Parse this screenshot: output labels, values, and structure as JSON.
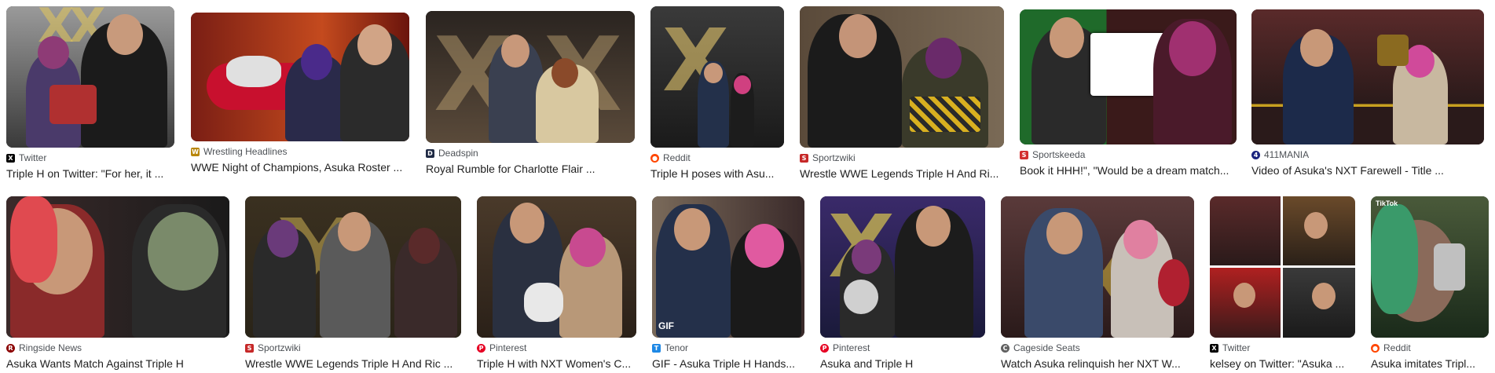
{
  "results": [
    {
      "source": "Twitter",
      "favicon": "x-logo-icon",
      "favicon_color": "#000000",
      "title": "Triple H on Twitter: \"For her, it ..."
    },
    {
      "source": "Wrestling Headlines",
      "favicon": "wrestling-headlines-icon",
      "favicon_color": "#b8860b",
      "title": "WWE Night of Champions, Asuka Roster ..."
    },
    {
      "source": "Deadspin",
      "favicon": "deadspin-icon",
      "favicon_color": "#1f2a44",
      "title": "Royal Rumble for Charlotte Flair ..."
    },
    {
      "source": "Reddit",
      "favicon": "reddit-icon",
      "favicon_color": "#ff4500",
      "title": "Triple H poses with Asu..."
    },
    {
      "source": "Sportzwiki",
      "favicon": "sportzwiki-icon",
      "favicon_color": "#c62828",
      "title": "Wrestle WWE Legends Triple H And Ri..."
    },
    {
      "source": "Sportskeeda",
      "favicon": "sportskeeda-icon",
      "favicon_color": "#d32f2f",
      "title": "Book it HHH!\", \"Would be a dream match..."
    },
    {
      "source": "411MANIA",
      "favicon": "411mania-icon",
      "favicon_color": "#1a237e",
      "title": "Video of Asuka's NXT Farewell - Title ..."
    },
    {
      "source": "Ringside News",
      "favicon": "ringside-news-icon",
      "favicon_color": "#8b0000",
      "title": "Asuka Wants Match Against Triple H"
    },
    {
      "source": "Sportzwiki",
      "favicon": "sportzwiki-icon",
      "favicon_color": "#c62828",
      "title": "Wrestle WWE Legends Triple H And Ric ..."
    },
    {
      "source": "Pinterest",
      "favicon": "pinterest-icon",
      "favicon_color": "#e60023",
      "title": "Triple H with NXT Women's C..."
    },
    {
      "source": "Tenor",
      "favicon": "tenor-icon",
      "favicon_color": "#1e88e5",
      "title": "GIF - Asuka Triple H Hands...",
      "badge": "GIF"
    },
    {
      "source": "Pinterest",
      "favicon": "pinterest-icon",
      "favicon_color": "#e60023",
      "title": "Asuka and Triple H"
    },
    {
      "source": "Cageside Seats",
      "favicon": "cageside-seats-icon",
      "favicon_color": "#616161",
      "title": "Watch Asuka relinquish her NXT W..."
    },
    {
      "source": "Twitter",
      "favicon": "x-logo-icon",
      "favicon_color": "#000000",
      "title": "kelsey on Twitter: \"Asuka ..."
    },
    {
      "source": "Reddit",
      "favicon": "reddit-icon",
      "favicon_color": "#ff4500",
      "title": "Asuka imitates Tripl...",
      "badge": "TikTok"
    }
  ]
}
